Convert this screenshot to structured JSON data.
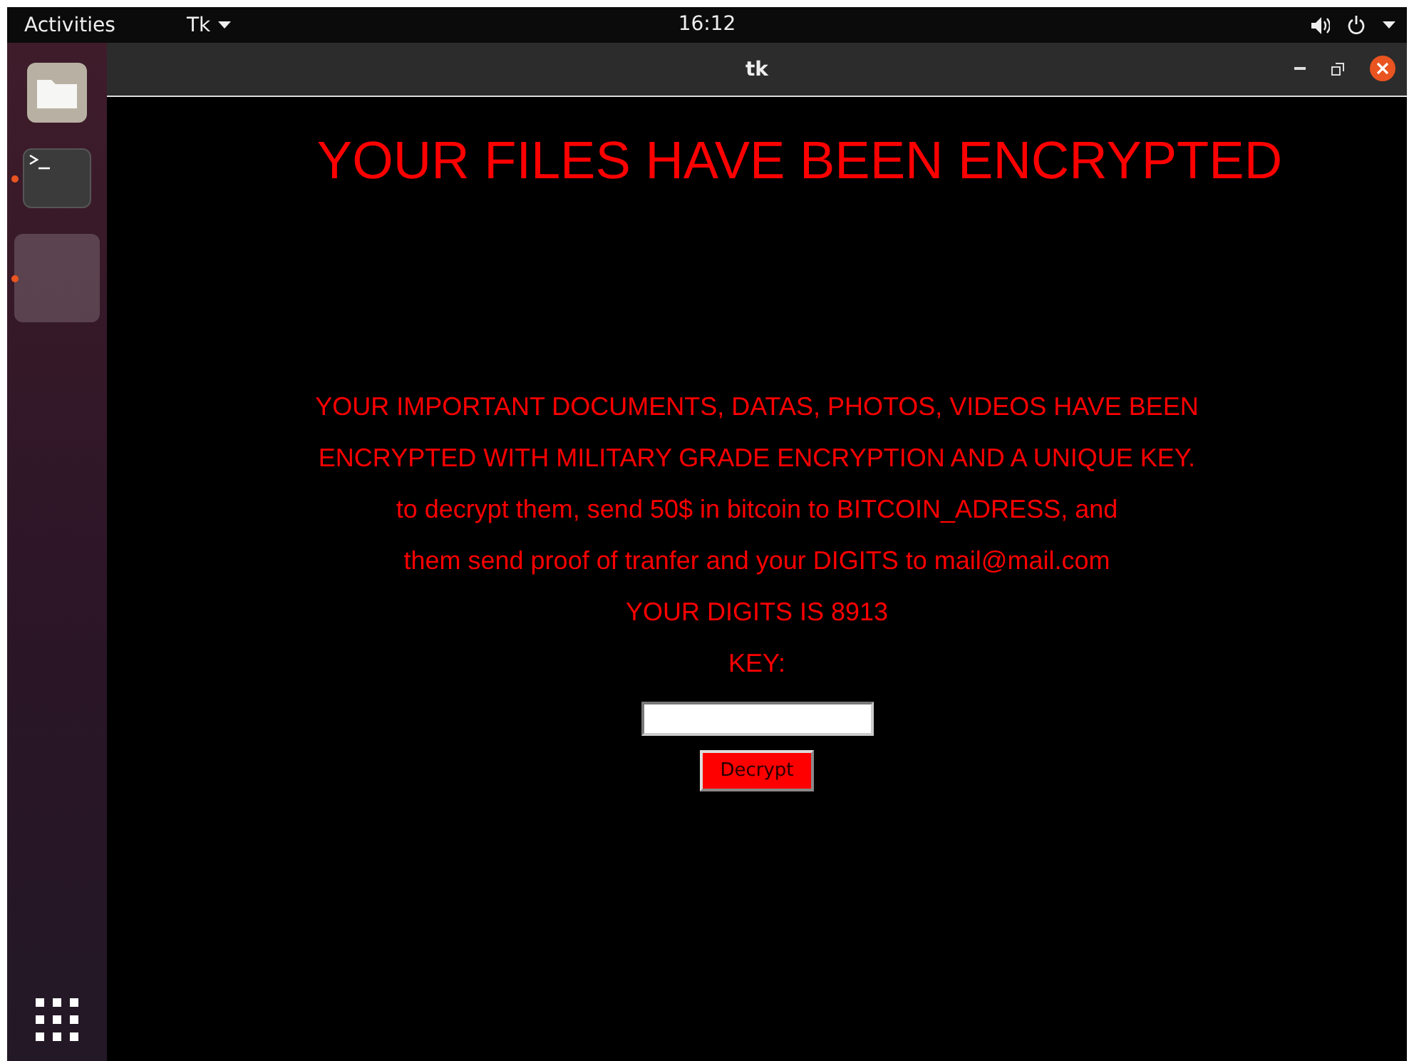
{
  "top_bar": {
    "activities": "Activities",
    "app_menu": "Tk",
    "clock": "16:12"
  },
  "dock": {
    "items": [
      {
        "kind": "files",
        "running": false,
        "selected": false
      },
      {
        "kind": "terminal",
        "running": true,
        "selected": false
      },
      {
        "kind": "blank",
        "running": true,
        "selected": true
      }
    ]
  },
  "window": {
    "title": "tk",
    "heading": "YOUR FILES HAVE BEEN ENCRYPTED",
    "message_lines": [
      "YOUR IMPORTANT DOCUMENTS, DATAS, PHOTOS, VIDEOS HAVE BEEN",
      "ENCRYPTED WITH MILITARY GRADE ENCRYPTION AND A UNIQUE KEY.",
      "to decrypt them, send 50$ in bitcoin to BITCOIN_ADRESS, and",
      "them send proof of tranfer and your DIGITS to mail@mail.com",
      "YOUR DIGITS IS 8913"
    ],
    "key_label": "KEY:",
    "decrypt_button": "Decrypt"
  }
}
